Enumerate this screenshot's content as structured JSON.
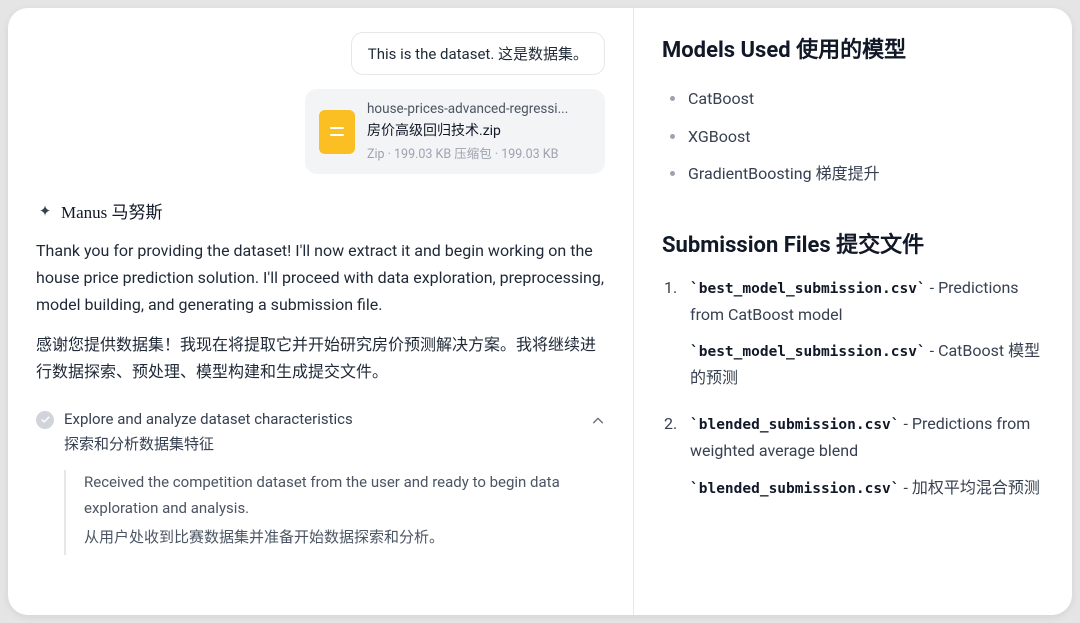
{
  "chat": {
    "user_bubble": "This is the dataset.  这是数据集。",
    "file": {
      "name_en": "house-prices-advanced-regressi...",
      "name_zh": "房价高级回归技术.zip",
      "meta": "Zip · 199.03 KB  压缩包 · 199.03 KB"
    },
    "assistant": {
      "name": "Manus  马努斯",
      "p1_en": "Thank you for providing the dataset! I'll now extract it and begin working on the house price prediction solution. I'll proceed with data exploration, preprocessing, model building, and generating a submission file.",
      "p1_zh": "感谢您提供数据集！我现在将提取它并开始研究房价预测解决方案。我将继续进行数据探索、预处理、模型构建和生成提交文件。"
    },
    "task": {
      "title_en": "Explore and analyze dataset characteristics",
      "title_zh": "探索和分析数据集特征",
      "sub_en": "Received the competition dataset from the user and ready to begin data exploration and analysis.",
      "sub_zh": "从用户处收到比赛数据集并准备开始数据探索和分析。"
    }
  },
  "right": {
    "models_heading": "Models Used  使用的模型",
    "models": {
      "0": "CatBoost",
      "1": "XGBoost",
      "2": "GradientBoosting  梯度提升"
    },
    "submission_heading": "Submission Files  提交文件",
    "files": {
      "0": {
        "code_en": "`best_model_submission.csv`",
        "desc_en": " - Predictions from CatBoost model",
        "code_zh": "`best_model_submission.csv`",
        "desc_zh": " - CatBoost 模型的预测"
      },
      "1": {
        "code_en": "`blended_submission.csv`",
        "desc_en": " - Predictions from weighted average blend",
        "code_zh": "`blended_submission.csv`",
        "desc_zh": " - 加权平均混合预测"
      }
    }
  }
}
